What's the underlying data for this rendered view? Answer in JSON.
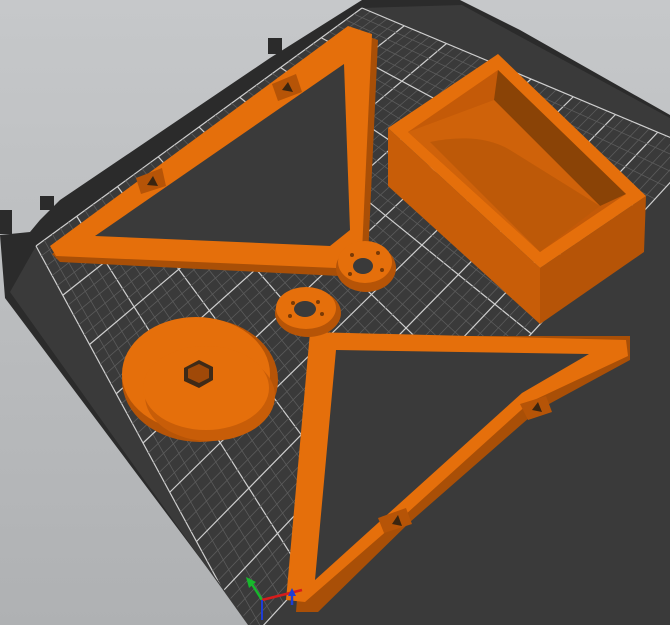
{
  "app": {
    "view": "3D plater view",
    "bed": {
      "surface_color": "#3a3a3a",
      "frame_color": "#2b2b2b",
      "grid_minor_color": "#5b5b5b",
      "grid_major_color": "#cfcfcf"
    },
    "objects": [
      {
        "name": "triangle-frame-top",
        "color": "#e56f0b"
      },
      {
        "name": "triangle-frame-bottom",
        "color": "#e56f0b"
      },
      {
        "name": "rectangular-box",
        "color": "#e56f0b"
      },
      {
        "name": "round-disc",
        "color": "#e56f0b"
      }
    ],
    "axes": {
      "x_color": "#d61c1c",
      "y_color": "#17b82c",
      "z_color": "#1e3dd6"
    }
  }
}
